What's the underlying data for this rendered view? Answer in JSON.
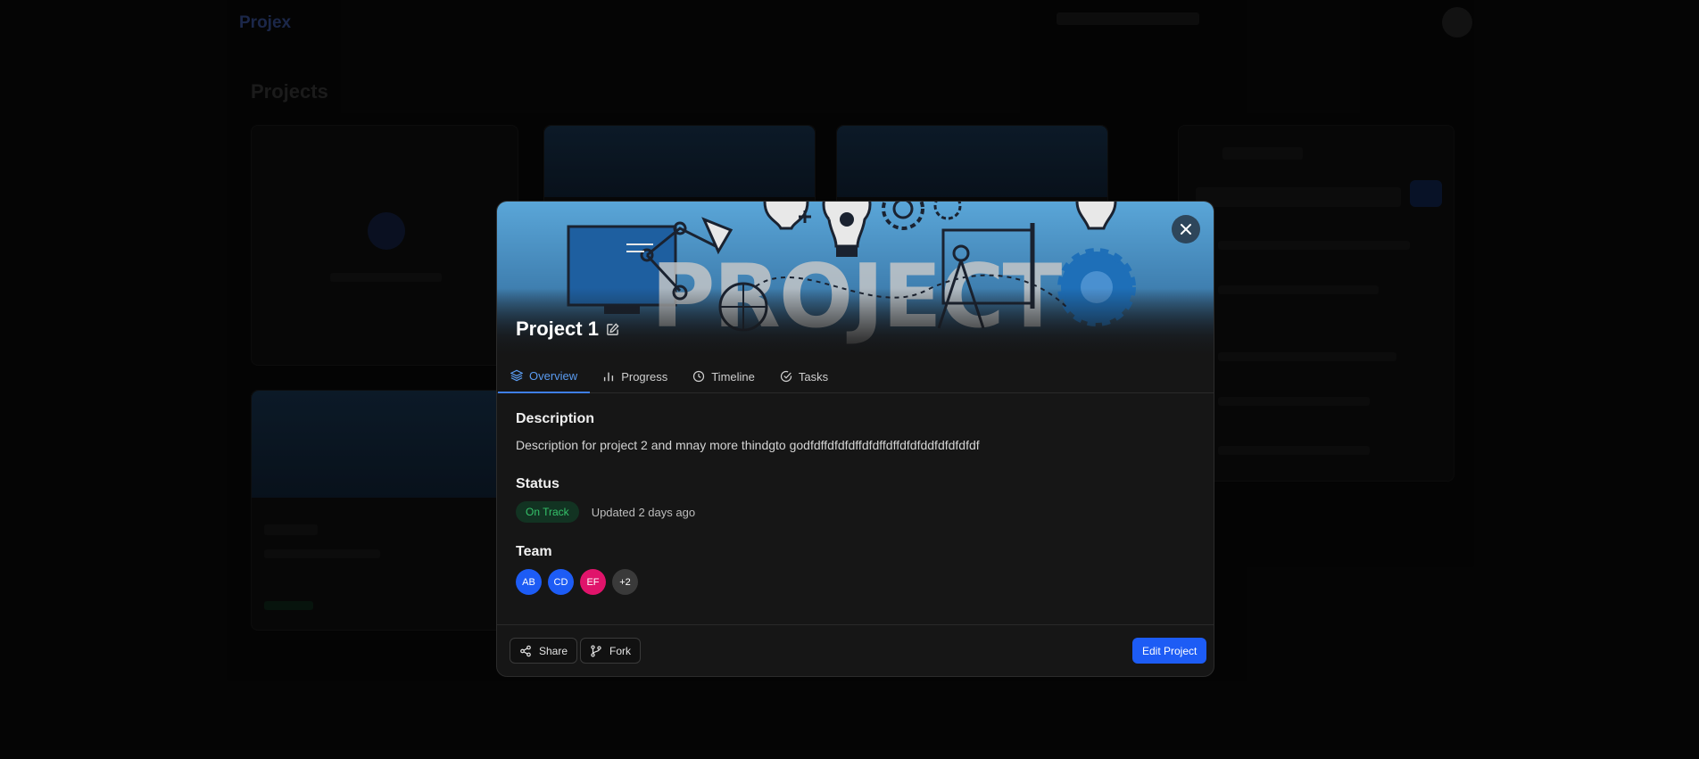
{
  "background": {
    "logo": "Projex",
    "heading": "Projects"
  },
  "modal": {
    "title": "Project 1",
    "tabs": [
      {
        "label": "Overview",
        "icon": "layers-icon",
        "active": true
      },
      {
        "label": "Progress",
        "icon": "bar-chart-icon",
        "active": false
      },
      {
        "label": "Timeline",
        "icon": "clock-icon",
        "active": false
      },
      {
        "label": "Tasks",
        "icon": "check-circle-icon",
        "active": false
      }
    ],
    "description_heading": "Description",
    "description": "Description for project 2 and mnay more thindgto godfdffdfdfdffdfdffdffdfdfddfdfdfdfdf",
    "status_heading": "Status",
    "status_badge": "On Track",
    "status_updated": "Updated 2 days ago",
    "team_heading": "Team",
    "team": [
      {
        "initials": "AB",
        "color": "#1d5cf5"
      },
      {
        "initials": "CD",
        "color": "#1d5cf5"
      },
      {
        "initials": "EF",
        "color": "#e0146b"
      },
      {
        "initials": "+2",
        "color": "#3a3a3a"
      }
    ],
    "footer": {
      "share_label": "Share",
      "fork_label": "Fork",
      "edit_label": "Edit Project"
    }
  },
  "colors": {
    "accent": "#1d5cf5",
    "status_green": "#35c26a",
    "active_tab": "#5a9bf0"
  }
}
